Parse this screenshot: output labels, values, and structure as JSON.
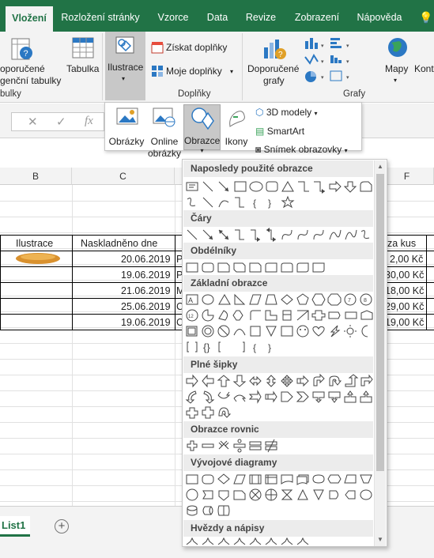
{
  "tabs": [
    {
      "label": "Vložení",
      "active": true
    },
    {
      "label": "Rozložení stránky"
    },
    {
      "label": "Vzorce"
    },
    {
      "label": "Data"
    },
    {
      "label": "Revize"
    },
    {
      "label": "Zobrazení"
    },
    {
      "label": "Nápověda"
    },
    {
      "label": "💡"
    }
  ],
  "ribbon": {
    "pivot": "oporučené",
    "pivot2": "genční tabulky",
    "table": "Tabulka",
    "group_tables": "bulky",
    "illustrations": "Ilustrace",
    "get_addins": "Získat doplňky",
    "my_addins": "Moje doplňky",
    "group_addins": "Doplňky",
    "rec_charts": "Doporučené",
    "rec_charts2": "grafy",
    "maps": "Mapy",
    "kont": "Kont",
    "group_charts": "Grafy"
  },
  "illustrations_menu": {
    "pictures": "Obrázky",
    "online1": "Online",
    "online2": "obrázky",
    "shapes": "Obrazce",
    "icons": "Ikony",
    "models3d": "3D modely",
    "smartart": "SmartArt",
    "screenshot": "Snímek obrazovky"
  },
  "formula_bar": {
    "cancel": "✕",
    "enter": "✓",
    "fx": "fx"
  },
  "columns": [
    "B",
    "C",
    "F"
  ],
  "table": {
    "headers": {
      "ilustrace": "Ilustrace",
      "naskladneno": "Naskladněno dne",
      "price": "za kus"
    },
    "rows": [
      {
        "date": "20.06.2019",
        "c": "P",
        "price": "2,00 Kč"
      },
      {
        "date": "19.06.2019",
        "c": "P",
        "price": "30,00 Kč"
      },
      {
        "date": "21.06.2019",
        "c": "M",
        "price": "18,00 Kč"
      },
      {
        "date": "25.06.2019",
        "c": "C",
        "price": "29,00 Kč"
      },
      {
        "date": "19.06.2019",
        "c": "C",
        "price": "19,00 Kč"
      }
    ]
  },
  "sheet_tab": "List1",
  "add_sheet": "+",
  "shapes_gallery": {
    "sections": [
      "Naposledy použité obrazce",
      "Čáry",
      "Obdélníky",
      "Základní obrazce",
      "Plné šipky",
      "Obrazce rovnic",
      "Vývojové diagramy",
      "Hvězdy a nápisy"
    ]
  },
  "colors": {
    "accent": "#217346",
    "icon_blue": "#2b78c3",
    "selected": "#c8c8c8"
  }
}
